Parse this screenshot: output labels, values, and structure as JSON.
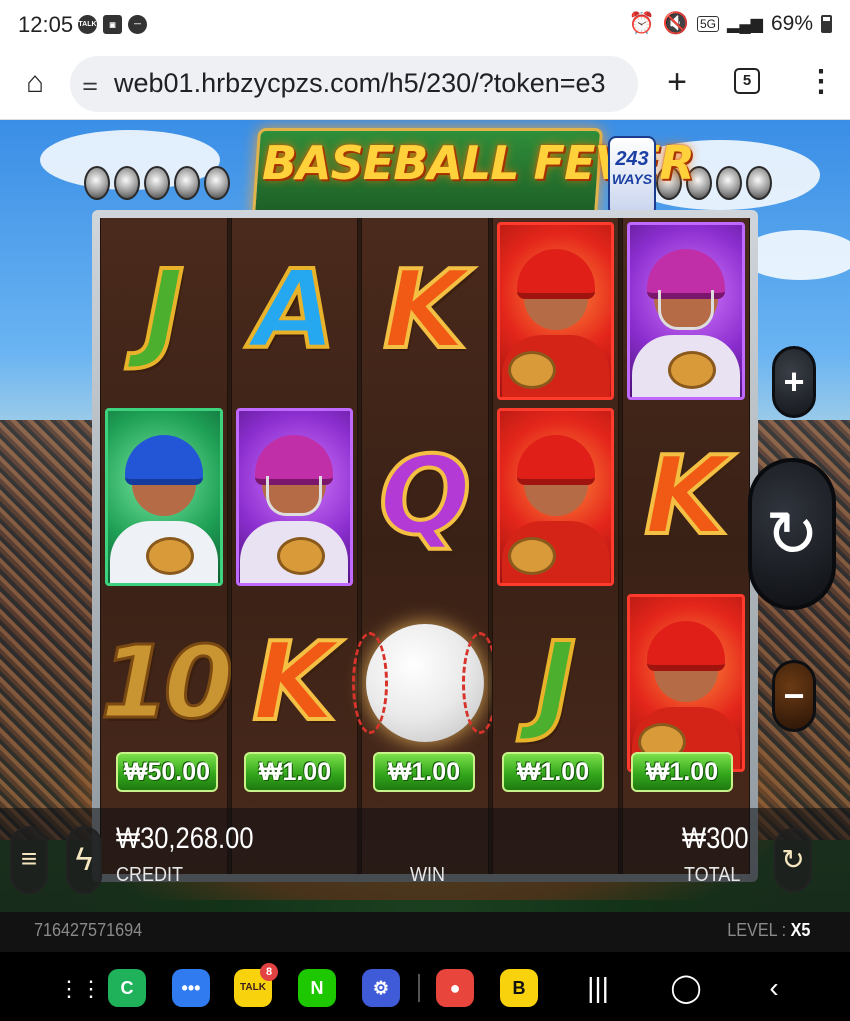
{
  "status_bar": {
    "time": "12:05",
    "notif_icons": [
      "talk-icon",
      "gallery-icon",
      "dnd-icon"
    ],
    "right_icons": [
      "alarm-icon",
      "mute-icon",
      "5g-icon",
      "signal-icon"
    ],
    "battery": "69%"
  },
  "browser": {
    "url": "web01.hrbzycpzs.com/h5/230/?token=e3",
    "tab_count": "5"
  },
  "game": {
    "title": "BASEBALL FEVER",
    "ways_number": "243",
    "ways_label": "WAYS",
    "reels": [
      [
        {
          "type": "letter",
          "text": "J",
          "color": "green"
        },
        {
          "type": "card",
          "card": "green-player"
        },
        {
          "type": "letter",
          "text": "10",
          "color": "gold"
        }
      ],
      [
        {
          "type": "letter",
          "text": "A",
          "color": "blue"
        },
        {
          "type": "card",
          "card": "purple-catcher"
        },
        {
          "type": "letter",
          "text": "K",
          "color": "orange"
        }
      ],
      [
        {
          "type": "letter",
          "text": "K",
          "color": "orange"
        },
        {
          "type": "letter",
          "text": "Q",
          "color": "purple"
        },
        {
          "type": "ball"
        }
      ],
      [
        {
          "type": "card",
          "card": "red-batter"
        },
        {
          "type": "card",
          "card": "red-batter"
        },
        {
          "type": "letter",
          "text": "J",
          "color": "green"
        }
      ],
      [
        {
          "type": "card",
          "card": "purple-catcher"
        },
        {
          "type": "letter",
          "text": "K",
          "color": "orange"
        },
        {
          "type": "card",
          "card": "red-batter"
        }
      ]
    ],
    "bets": [
      "₩50.00",
      "₩1.00",
      "₩1.00",
      "₩1.00",
      "₩1.00"
    ],
    "plus_label": "+",
    "minus_label": "−",
    "spin_label": "↻"
  },
  "panel": {
    "credit_value": "₩30,268.00",
    "credit_label": "CREDIT",
    "win_label": "WIN",
    "total_value": "₩300",
    "total_label": "TOTAL",
    "round_id": "716427571694",
    "level_label": "LEVEL : ",
    "level_value": "X5"
  },
  "nav": {
    "apps": [
      {
        "name": "phone-app-icon",
        "glyph": "C",
        "bg": "#1fb25a",
        "fg": "#fff"
      },
      {
        "name": "messages-app-icon",
        "glyph": "•••",
        "bg": "#2f7bef",
        "fg": "#fff"
      },
      {
        "name": "kakaotalk-app-icon",
        "glyph": "TALK",
        "bg": "#f8d20c",
        "fg": "#3a1d1d",
        "badge": "8"
      },
      {
        "name": "naver-app-icon",
        "glyph": "N",
        "bg": "#1ec800",
        "fg": "#fff"
      },
      {
        "name": "settings-app-icon",
        "glyph": "⚙",
        "bg": "#3f5bd8",
        "fg": "#fff"
      },
      {
        "name": "red-app-icon",
        "glyph": "●",
        "bg": "#e8453c",
        "fg": "#fff"
      },
      {
        "name": "kakao-b-app-icon",
        "glyph": "B",
        "bg": "#f8d20c",
        "fg": "#111"
      }
    ]
  },
  "colors": {
    "bet_green": "#34a71c",
    "title_gold": "#ffd23c",
    "card_red": "#e4261b",
    "card_purple": "#8b2ecf",
    "card_green": "#1fa156"
  }
}
